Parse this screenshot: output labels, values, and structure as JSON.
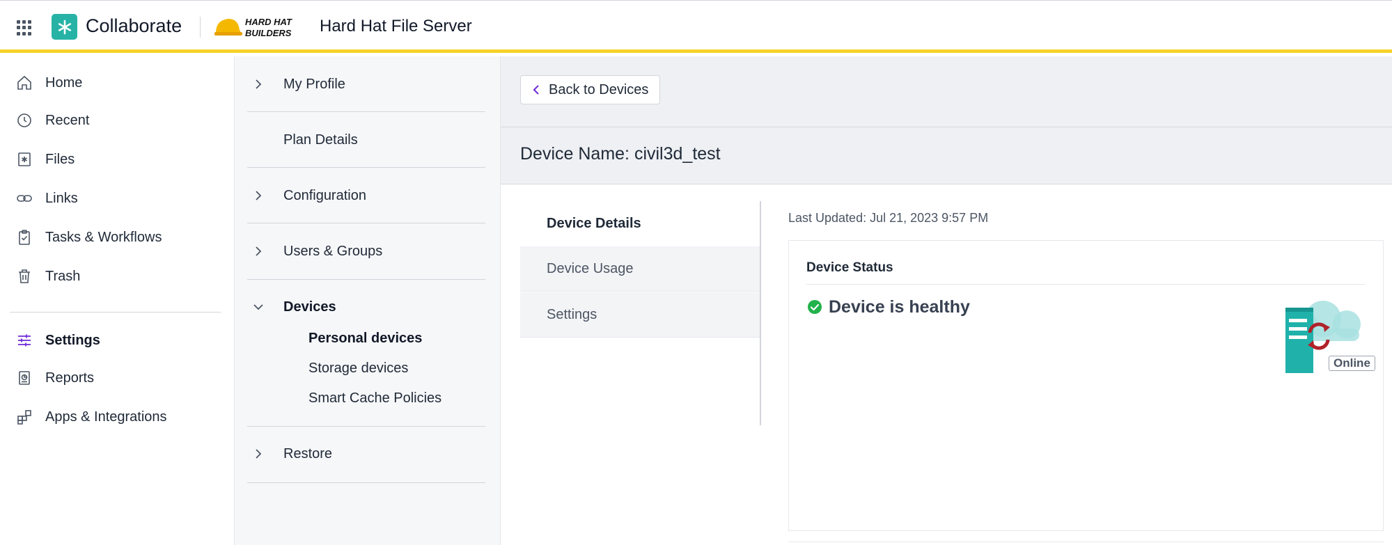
{
  "header": {
    "app_name": "Collaborate",
    "company_logo_text": "HARD HAT BUILDERS",
    "server_name": "Hard Hat File Server"
  },
  "colors": {
    "accent_yellow": "#f7d32a",
    "brand_teal": "#26b3a6",
    "settings_purple": "#6d28d9",
    "healthy_green": "#22b24c"
  },
  "leftnav": {
    "items": [
      {
        "label": "Home",
        "icon": "home-icon"
      },
      {
        "label": "Recent",
        "icon": "clock-icon"
      },
      {
        "label": "Files",
        "icon": "files-icon"
      },
      {
        "label": "Links",
        "icon": "link-icon"
      },
      {
        "label": "Tasks & Workflows",
        "icon": "clipboard-check-icon"
      },
      {
        "label": "Trash",
        "icon": "trash-icon"
      },
      {
        "label": "Settings",
        "icon": "sliders-icon",
        "active": true
      },
      {
        "label": "Reports",
        "icon": "report-icon"
      },
      {
        "label": "Apps & Integrations",
        "icon": "apps-icon"
      }
    ]
  },
  "subnav": {
    "items": [
      {
        "label": "My Profile",
        "expandable": true
      },
      {
        "label": "Plan Details",
        "expandable": false
      },
      {
        "label": "Configuration",
        "expandable": true
      },
      {
        "label": "Users & Groups",
        "expandable": true
      },
      {
        "label": "Devices",
        "expandable": true,
        "expanded": true
      },
      {
        "label": "Restore",
        "expandable": true
      }
    ],
    "devices_children": [
      {
        "label": "Personal devices",
        "active": true
      },
      {
        "label": "Storage devices"
      },
      {
        "label": "Smart Cache Policies"
      }
    ]
  },
  "main": {
    "back_label": "Back to Devices",
    "device_title": "Device Name: civil3d_test",
    "tabs": [
      {
        "label": "Device Details",
        "active": true
      },
      {
        "label": "Device Usage"
      },
      {
        "label": "Settings"
      }
    ],
    "last_updated": "Last Updated: Jul 21, 2023 9:57 PM",
    "status_card": {
      "title": "Device Status",
      "message": "Device is healthy",
      "badge": "Online"
    }
  }
}
